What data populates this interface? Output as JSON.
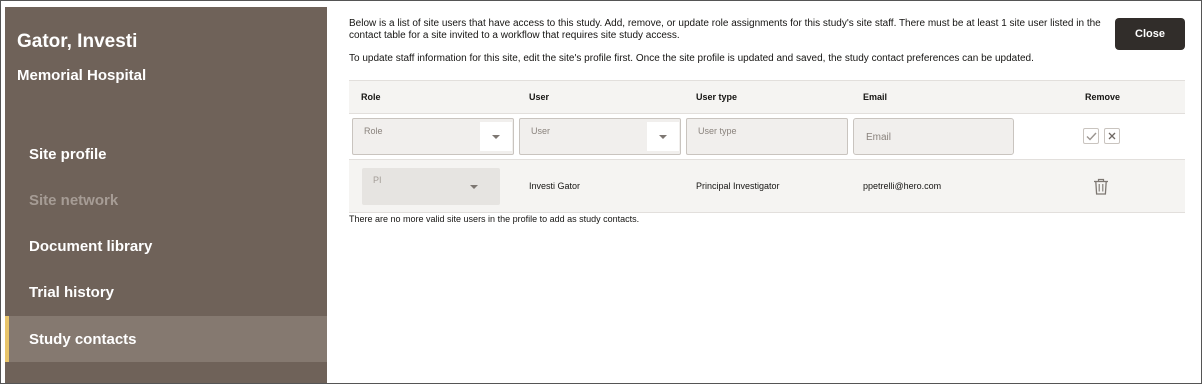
{
  "sidebar": {
    "site_name": "Gator, Investi",
    "hospital": "Memorial Hospital",
    "items": [
      {
        "label": "Site profile",
        "state": "normal"
      },
      {
        "label": "Site network",
        "state": "disabled"
      },
      {
        "label": "Document library",
        "state": "normal"
      },
      {
        "label": "Trial history",
        "state": "normal"
      },
      {
        "label": "Study contacts",
        "state": "active"
      }
    ]
  },
  "header": {
    "description_1_line_1": "Below is a list of site users that have access to this study. Add, remove, or update role assignments for this study's site staff. There must be at least 1 site user listed in the",
    "description_1_line_2": "contact table for a site invited to a workflow that requires site study access.",
    "description_2": "To update staff information for this site, edit the site's profile first. Once the site profile is updated and saved, the study contact preferences can be updated.",
    "close_label": "Close"
  },
  "table": {
    "columns": {
      "role": "Role",
      "user": "User",
      "user_type": "User type",
      "email": "Email",
      "remove": "Remove"
    },
    "edit_row": {
      "role_placeholder": "Role",
      "user_placeholder": "User",
      "user_type_placeholder": "User type",
      "email_placeholder": "Email"
    },
    "rows": [
      {
        "role": "PI",
        "user": "Investi Gator",
        "user_type": "Principal Investigator",
        "email": "ppetrelli@hero.com"
      }
    ],
    "note": "There are no more valid site users in the profile to add as study contacts."
  },
  "colors": {
    "sidebar_bg": "#6f6259",
    "active_item_bg": "#857970",
    "active_accent": "#e9c56a",
    "close_button_bg": "#312d2a"
  },
  "icons": [
    "caret-down-icon",
    "check-icon",
    "close-icon",
    "trash-icon"
  ]
}
